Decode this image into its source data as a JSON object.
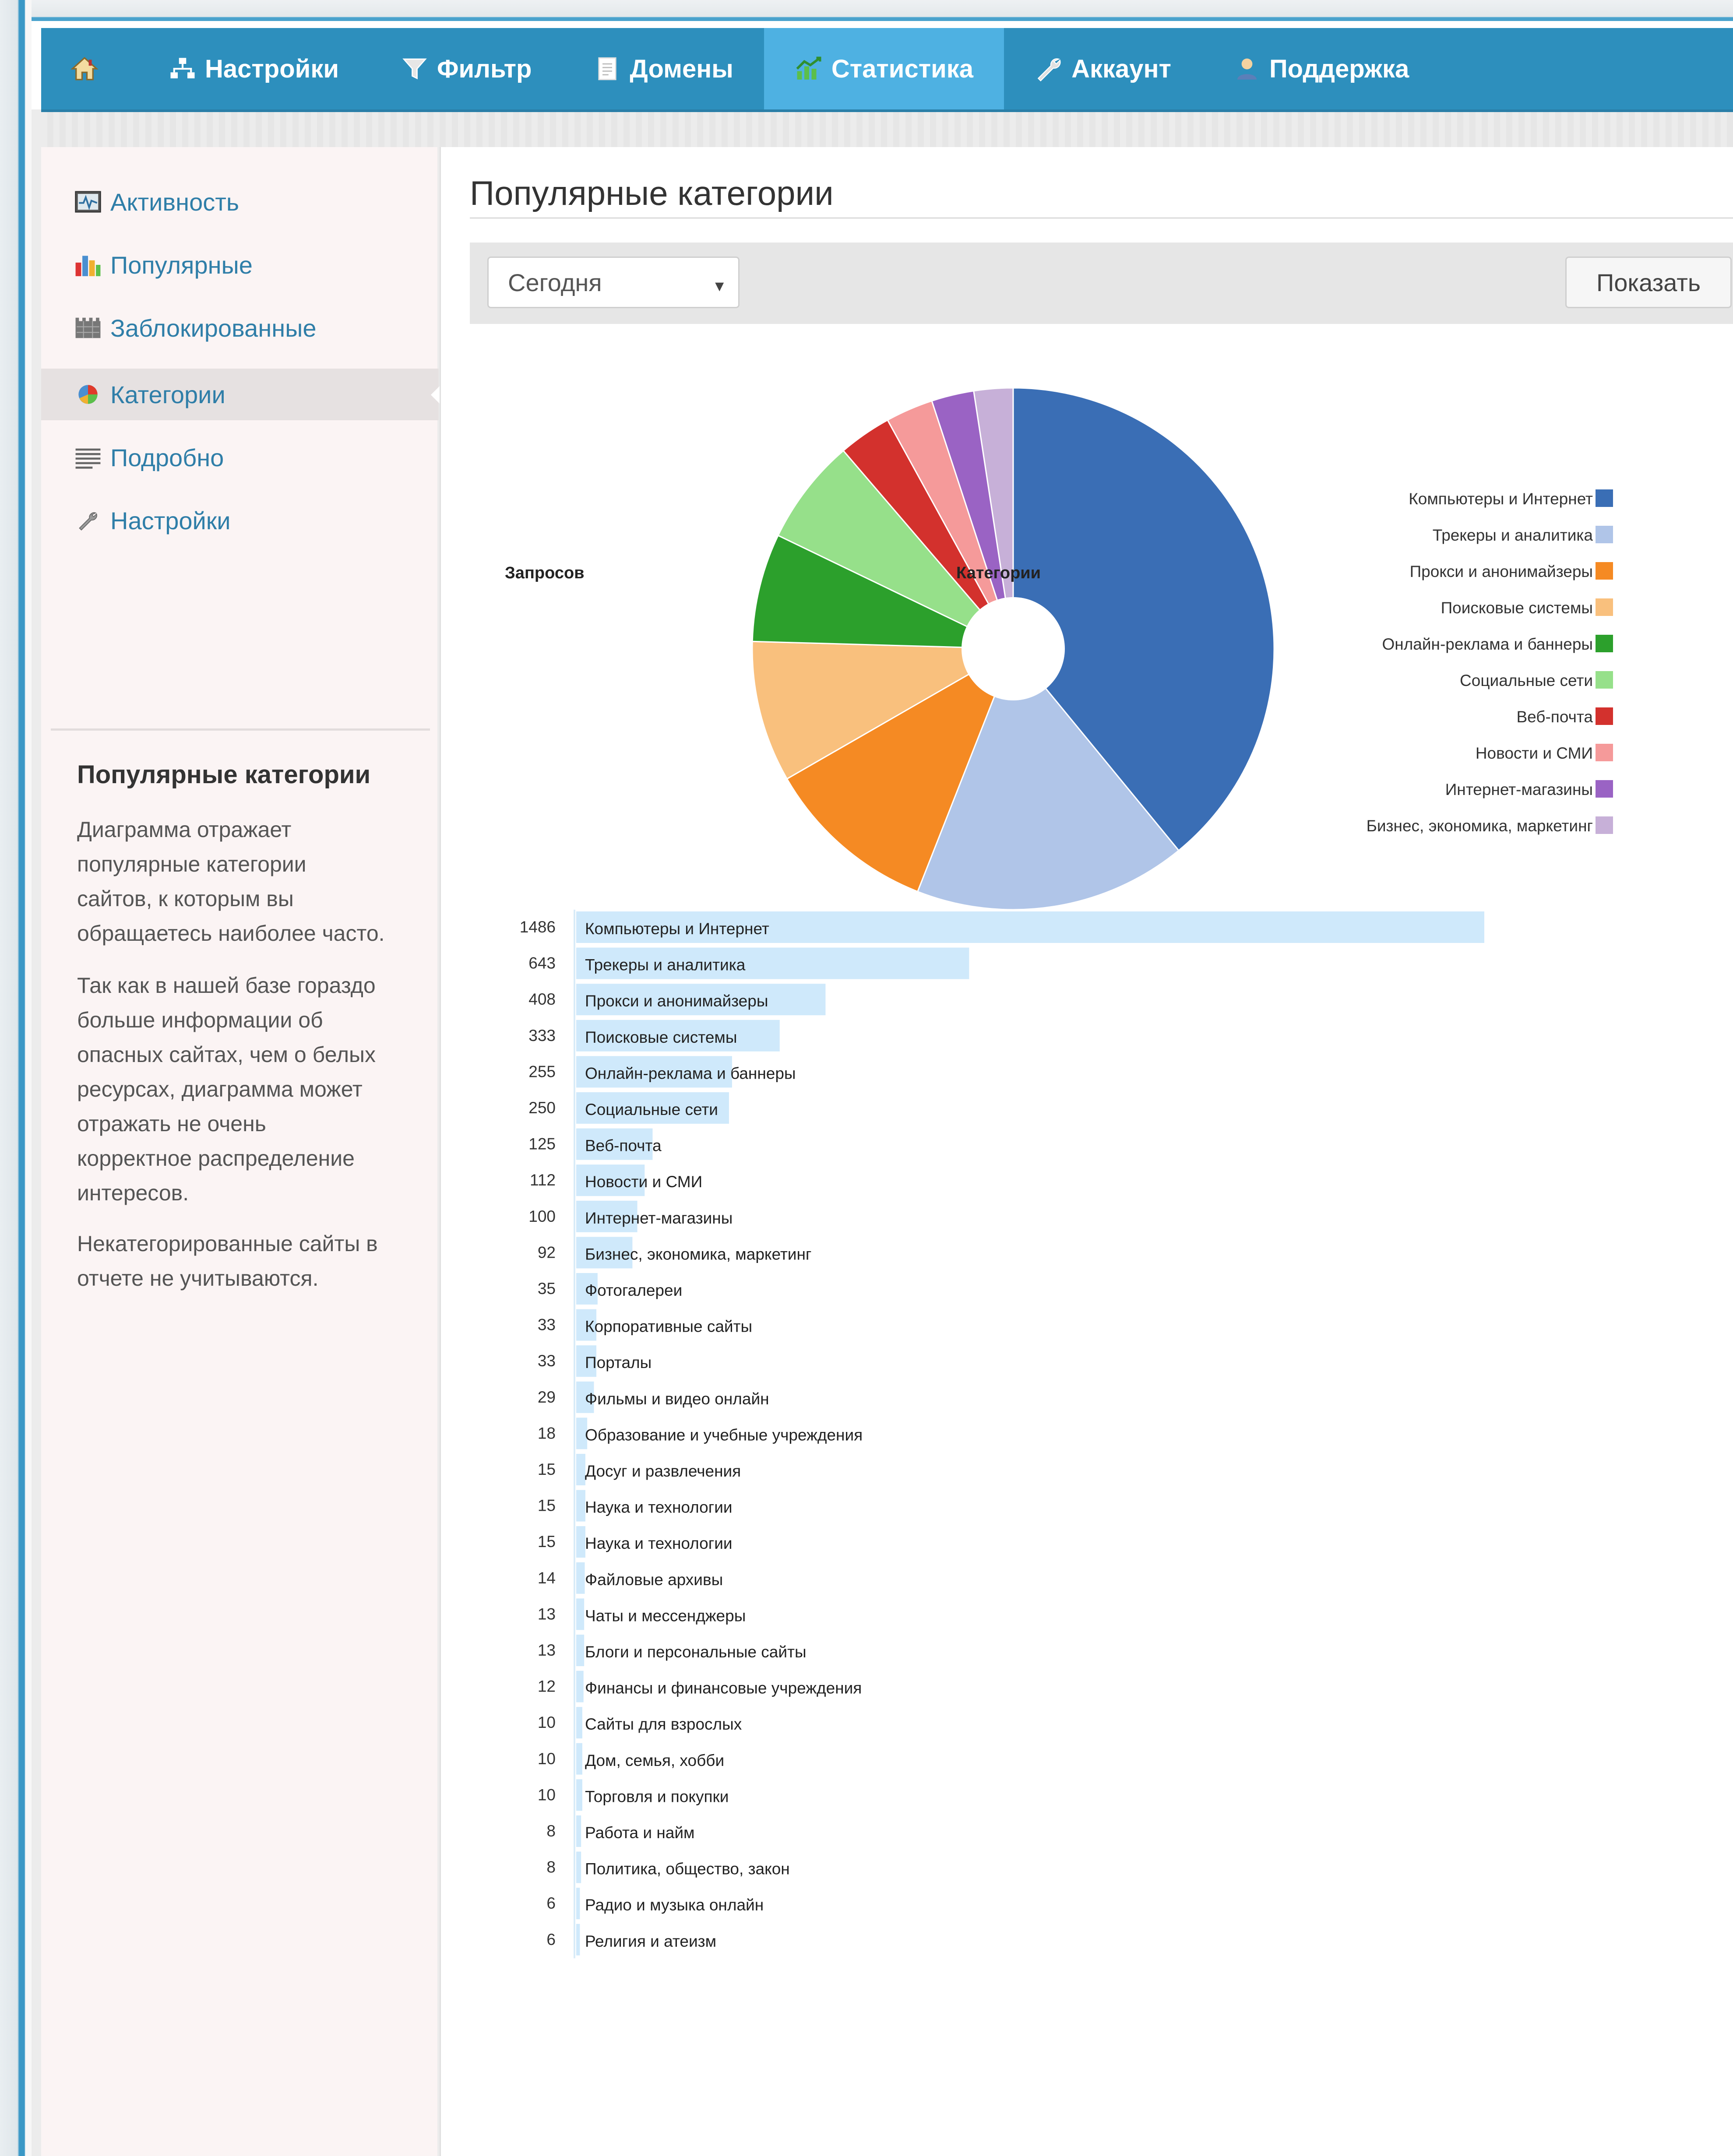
{
  "navbar": {
    "items": [
      {
        "label": "",
        "icon": "home-icon"
      },
      {
        "label": "Настройки",
        "icon": "sitemap-icon"
      },
      {
        "label": "Фильтр",
        "icon": "filter-icon"
      },
      {
        "label": "Домены",
        "icon": "document-icon"
      },
      {
        "label": "Статистика",
        "icon": "chart-icon",
        "active": true
      },
      {
        "label": "Аккаунт",
        "icon": "wrench-icon"
      },
      {
        "label": "Поддержка",
        "icon": "user-icon"
      }
    ]
  },
  "sidebar": {
    "items": [
      {
        "label": "Активность",
        "icon": "activity-icon"
      },
      {
        "label": "Популярные",
        "icon": "bar-chart-icon"
      },
      {
        "label": "Заблокированные",
        "icon": "blocked-icon"
      },
      {
        "label": "Категории",
        "icon": "pie-chart-icon",
        "active": true
      },
      {
        "label": "Подробно",
        "icon": "list-icon"
      },
      {
        "label": "Настройки",
        "icon": "wrench-icon"
      }
    ],
    "info_title": "Популярные категории",
    "paragraphs": [
      [
        "Диаграмма отражает",
        "популярные категории",
        "сайтов, к которым вы",
        "обращаетесь наиболее часто."
      ],
      [
        "Так как в нашей базе гораздо",
        "больше информации об",
        "опасных сайтах, чем о белых",
        "ресурсах, диаграмма может",
        "отражать не очень",
        "корректное распределение",
        "интересов."
      ],
      [
        "Некатегорированные сайты в",
        "отчете не учитываются."
      ]
    ]
  },
  "main": {
    "title": "Популярные категории",
    "period_select": "Сегодня",
    "show_button": "Показать"
  },
  "colors": {
    "navbar": "#2d8fbd",
    "navbar_active": "#4eb1e2",
    "link": "#2f7ea8",
    "bar": "#cfe9fb"
  },
  "chart_data": [
    {
      "type": "pie",
      "legend_position": "right",
      "donut_hole": true,
      "categories": [
        "Компьютеры и Интернет",
        "Трекеры и аналитика",
        "Прокси и анонимайзеры",
        "Поисковые системы",
        "Онлайн-реклама и баннеры",
        "Социальные сети",
        "Веб-почта",
        "Новости и СМИ",
        "Интернет-магазины",
        "Бизнес, экономика, маркетинг"
      ],
      "values": [
        1486,
        643,
        408,
        333,
        255,
        250,
        125,
        112,
        100,
        92
      ],
      "colors": [
        "#3a6eb5",
        "#b0c5e8",
        "#f58a23",
        "#f9c07d",
        "#2ca02c",
        "#96e08a",
        "#d3312d",
        "#f59a9a",
        "#9a63c4",
        "#c7b0d8"
      ]
    },
    {
      "type": "bar",
      "orientation": "horizontal",
      "headers": {
        "count": "Запросов",
        "category": "Категории"
      },
      "rows": [
        {
          "count": "1486",
          "label": "Компьютеры и Интернет",
          "value": 1486
        },
        {
          "count": "643",
          "label": "Трекеры и аналитика",
          "value": 643
        },
        {
          "count": "408",
          "label": "Прокси и анонимайзеры",
          "value": 408
        },
        {
          "count": "333",
          "label": "Поисковые системы",
          "value": 333
        },
        {
          "count": "255",
          "label": "Онлайн-реклама и баннеры",
          "value": 255
        },
        {
          "count": "250",
          "label": "Социальные сети",
          "value": 250
        },
        {
          "count": "125",
          "label": "Веб-почта",
          "value": 125
        },
        {
          "count": "112",
          "label": "Новости и СМИ",
          "value": 112
        },
        {
          "count": "100",
          "label": "Интернет-магазины",
          "value": 100
        },
        {
          "count": "92",
          "label": "Бизнес, экономика, маркетинг",
          "value": 92
        },
        {
          "count": "35",
          "label": "Фотогалереи",
          "value": 35
        },
        {
          "count": "33",
          "label": "Корпоративные сайты",
          "value": 33
        },
        {
          "count": "33",
          "label": "Порталы",
          "value": 33
        },
        {
          "count": "29",
          "label": "Фильмы и видео онлайн",
          "value": 29
        },
        {
          "count": "18",
          "label": "Образование и учебные учреждения",
          "value": 18
        },
        {
          "count": "15",
          "label": "Досуг и развлечения",
          "value": 15
        },
        {
          "count": "15",
          "label": "Наука и технологии",
          "value": 15
        },
        {
          "count": "15",
          "label": "Наука и технологии",
          "value": 15
        },
        {
          "count": "14",
          "label": "Файловые архивы",
          "value": 14
        },
        {
          "count": "13",
          "label": "Чаты и мессенджеры",
          "value": 13
        },
        {
          "count": "13",
          "label": "Блоги и персональные сайты",
          "value": 13
        },
        {
          "count": "12",
          "label": "Финансы и финансовые учреждения",
          "value": 12
        },
        {
          "count": "10",
          "label": "Сайты для взрослых",
          "value": 10
        },
        {
          "count": "10",
          "label": "Дом, семья, хобби",
          "value": 10
        },
        {
          "count": "10",
          "label": "Торговля и покупки",
          "value": 10
        },
        {
          "count": "8",
          "label": "Работа и найм",
          "value": 8
        },
        {
          "count": "8",
          "label": "Политика, общество, закон",
          "value": 8
        },
        {
          "count": "6",
          "label": "Радио и музыка онлайн",
          "value": 6
        },
        {
          "count": "6",
          "label": "Религия и атеизм",
          "value": 6
        }
      ]
    }
  ]
}
